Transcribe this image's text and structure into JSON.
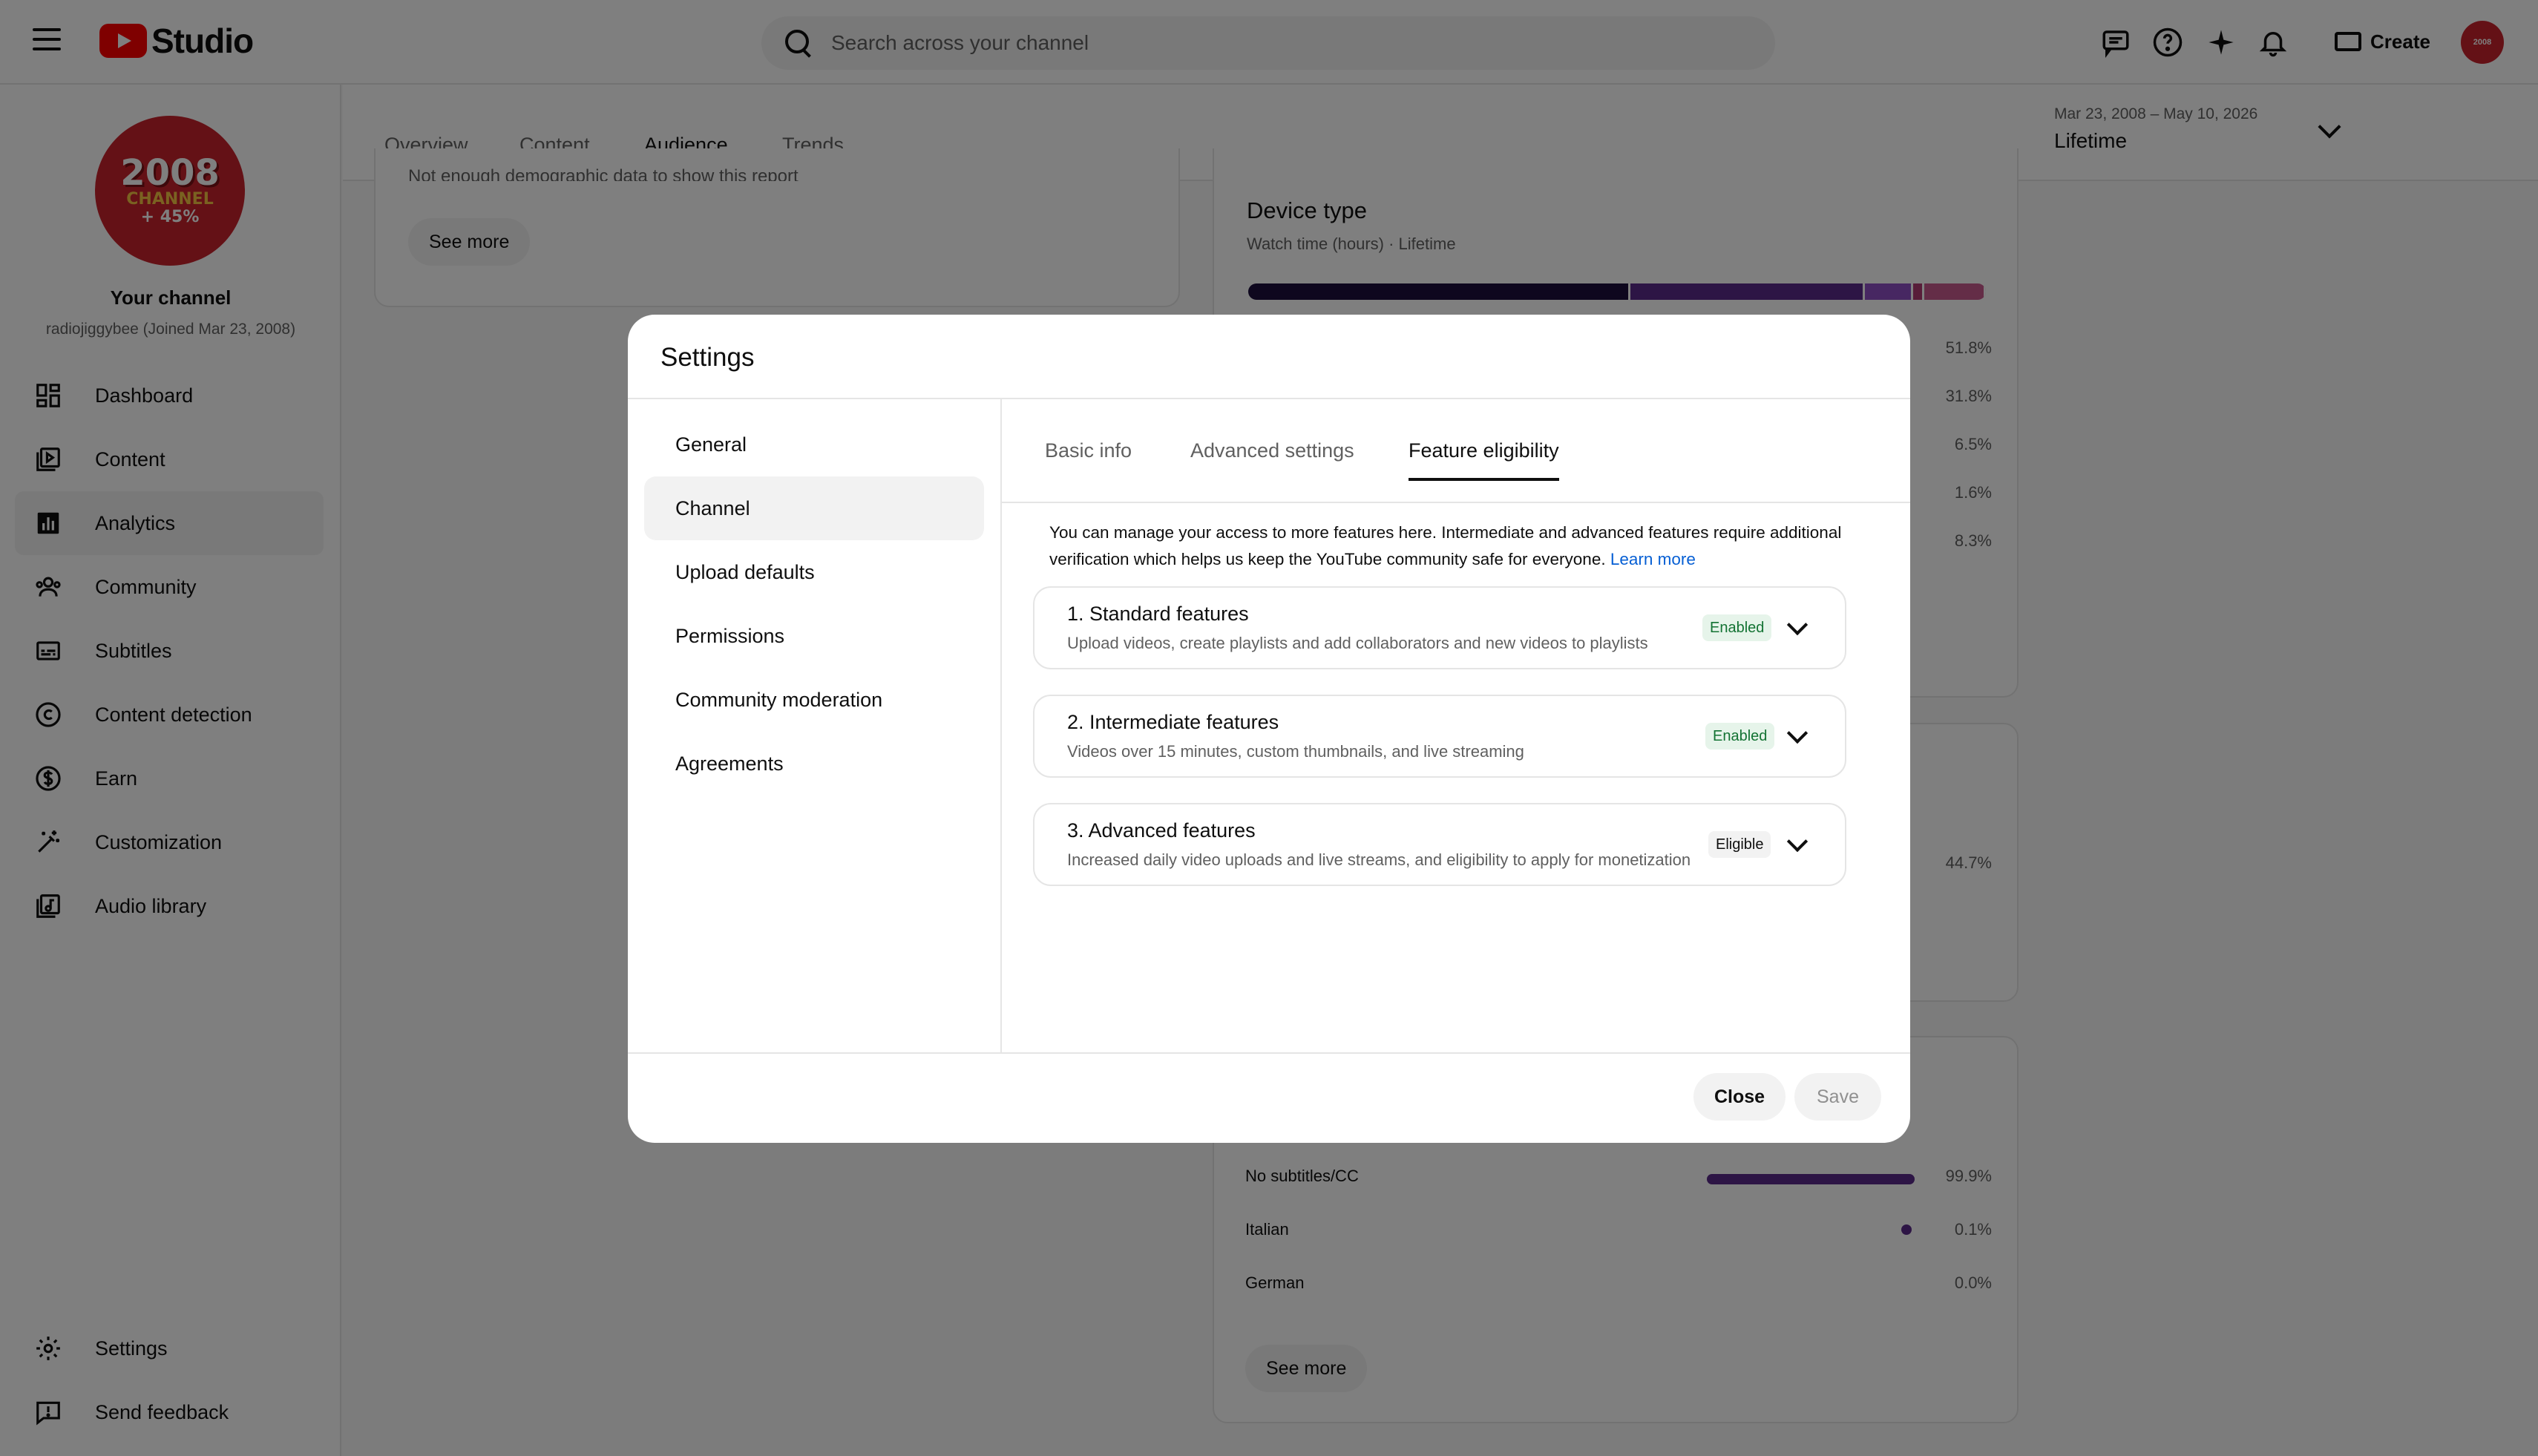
{
  "header": {
    "logo_text": "Studio",
    "search_placeholder": "Search across your channel",
    "create_label": "Create",
    "avatar_text": "2008"
  },
  "sidebar": {
    "avatar": {
      "line1": "2008",
      "line2": "CHANNEL",
      "line3": "+ 45%"
    },
    "channel_title": "Your channel",
    "channel_sub": "radiojiggybee (Joined Mar 23, 2008)",
    "items": [
      {
        "label": "Dashboard",
        "icon": "dashboard-icon"
      },
      {
        "label": "Content",
        "icon": "content-icon"
      },
      {
        "label": "Analytics",
        "icon": "analytics-icon",
        "active": true
      },
      {
        "label": "Community",
        "icon": "community-icon"
      },
      {
        "label": "Subtitles",
        "icon": "subtitles-icon"
      },
      {
        "label": "Content detection",
        "icon": "copyright-icon"
      },
      {
        "label": "Earn",
        "icon": "dollar-icon"
      },
      {
        "label": "Customization",
        "icon": "magic-wand-icon"
      },
      {
        "label": "Audio library",
        "icon": "audio-library-icon"
      }
    ],
    "bottom": [
      {
        "label": "Settings",
        "icon": "gear-icon"
      },
      {
        "label": "Send feedback",
        "icon": "feedback-icon"
      }
    ]
  },
  "tabs": [
    "Overview",
    "Content",
    "Audience",
    "Trends"
  ],
  "date_range": {
    "range": "Mar 23, 2008 – May 10, 2026",
    "label": "Lifetime"
  },
  "background": {
    "demographic_note": "Not enough demographic data to show this report",
    "see_more": "See more",
    "device": {
      "title": "Device type",
      "subtitle": "Watch time (hours) · Lifetime",
      "percents": [
        "51.8%",
        "31.8%",
        "6.5%",
        "1.6%",
        "8.3%"
      ],
      "bar_colors": [
        "#1c0f3d",
        "#5b2a8a",
        "#8e4fc4",
        "#b13b73",
        "#c95b8e"
      ]
    },
    "mid_pct": "44.7%",
    "subtitles": {
      "rows": [
        {
          "label": "No subtitles/CC",
          "pct": "99.9%",
          "fill": 0.999
        },
        {
          "label": "Italian",
          "pct": "0.1%",
          "fill": 0.001
        },
        {
          "label": "German",
          "pct": "0.0%",
          "fill": 0
        }
      ],
      "see_more": "See more"
    }
  },
  "modal": {
    "title": "Settings",
    "nav": [
      "General",
      "Channel",
      "Upload defaults",
      "Permissions",
      "Community moderation",
      "Agreements"
    ],
    "tabs": [
      "Basic info",
      "Advanced settings",
      "Feature eligibility"
    ],
    "intro": "You can manage your access to more features here. Intermediate and advanced features require additional verification which helps us keep the YouTube community safe for everyone.",
    "learn_more": "Learn more",
    "features": [
      {
        "title": "1. Standard features",
        "desc": "Upload videos, create playlists and add collaborators and new videos to playlists",
        "status": "Enabled"
      },
      {
        "title": "2. Intermediate features",
        "desc": "Videos over 15 minutes, custom thumbnails, and live streaming",
        "status": "Enabled"
      },
      {
        "title": "3. Advanced features",
        "desc": "Increased daily video uploads and live streams, and eligibility to apply for monetization",
        "status": "Eligible"
      }
    ],
    "close_label": "Close",
    "save_label": "Save"
  }
}
